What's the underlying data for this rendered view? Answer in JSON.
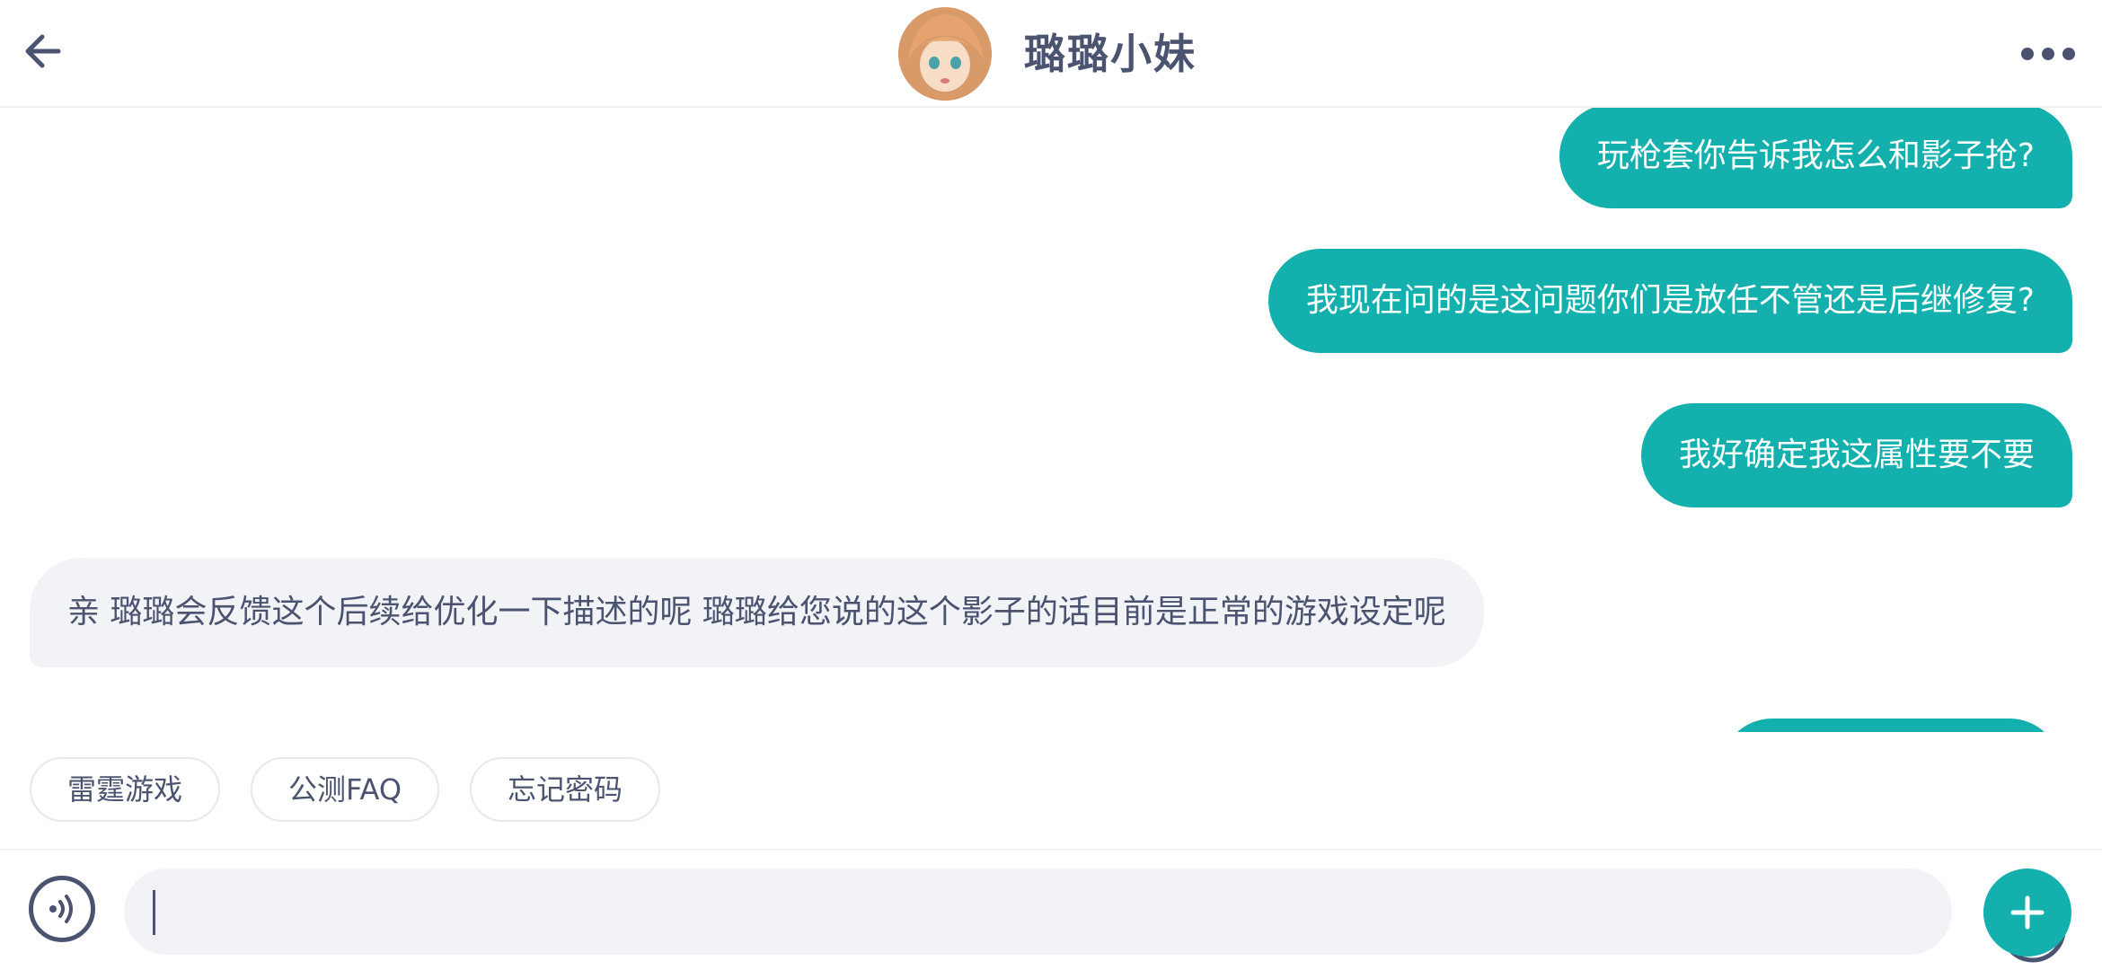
{
  "header": {
    "contact_name": "璐璐小妹",
    "back_icon": "arrow-left-icon",
    "more_icon": "more-horizontal-icon"
  },
  "messages": [
    {
      "direction": "out",
      "text": "玩枪套你告诉我怎么和影子抢?"
    },
    {
      "direction": "out",
      "text": "我现在问的是这问题你们是放任不管还是后继修复?"
    },
    {
      "direction": "out",
      "text": "我好确定我这属性要不要"
    },
    {
      "direction": "in",
      "text": "亲 璐璐会反馈这个后续给优化一下描述的呢 璐璐给您说的这个影子的话目前是正常的游戏设定呢"
    }
  ],
  "quick_replies": [
    "雷霆游戏",
    "公测FAQ",
    "忘记密码"
  ],
  "input": {
    "value": "",
    "placeholder": ""
  },
  "colors": {
    "accent": "#13b0ae",
    "text": "#4a5370",
    "bubble_in": "#f1f3f7"
  }
}
